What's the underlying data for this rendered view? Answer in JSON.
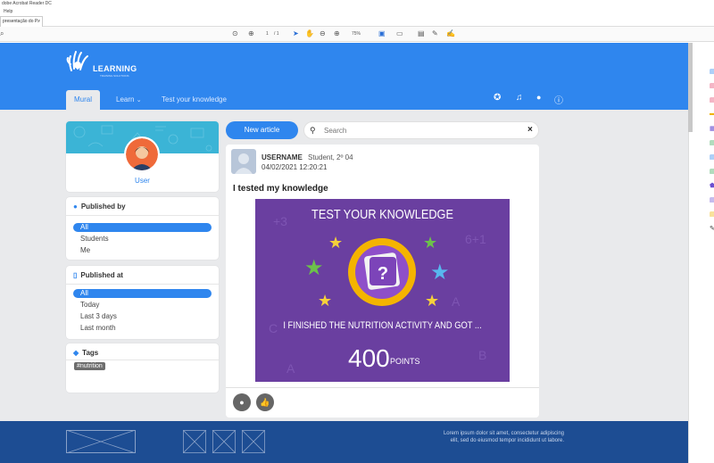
{
  "window": {
    "title": "dobe Acrobat Reader DC",
    "menu_help": "Help",
    "tab_label": "presentação do P..",
    "tab_close": "×"
  },
  "toolbar": {
    "page_current": "1",
    "page_total": "/ 1",
    "zoom": "75%"
  },
  "app": {
    "logo_text": "LEARNING",
    "logo_subtitle": "TRAINING SOLUTIONS",
    "nav": {
      "mural": "Mural",
      "learn": "Learn",
      "test": "Test your knowledge"
    },
    "colors": {
      "primary": "#2f86ee",
      "footer": "#1d4d93",
      "image_bg": "#6a3fa0"
    }
  },
  "profile": {
    "user_label": "User"
  },
  "published_by": {
    "title": "Published by",
    "options": [
      "All",
      "Students",
      "Me"
    ],
    "selected": "All"
  },
  "published_at": {
    "title": "Published at",
    "options": [
      "All",
      "Today",
      "Last 3 days",
      "Last month"
    ],
    "selected": "All"
  },
  "tags": {
    "title": "Tags",
    "items": [
      "#nutrition"
    ]
  },
  "actions": {
    "new_article": "New article"
  },
  "search": {
    "placeholder": "Search"
  },
  "post": {
    "username": "USERNAME",
    "role": "Student, 2º 04",
    "date": "04/02/2021  12:20:21",
    "title": "I tested my knowledge",
    "image": {
      "heading": "TEST YOUR KNOWLEDGE",
      "message": "I FINISHED THE NUTRITION ACTIVITY AND GOT ...",
      "score": "400",
      "score_unit": "POINTS"
    }
  },
  "footer": {
    "text": "Lorem ipsum dolor sit amet, consectetur adipiscing elit, sed do eiusmod tempor incididunt ut labore."
  }
}
